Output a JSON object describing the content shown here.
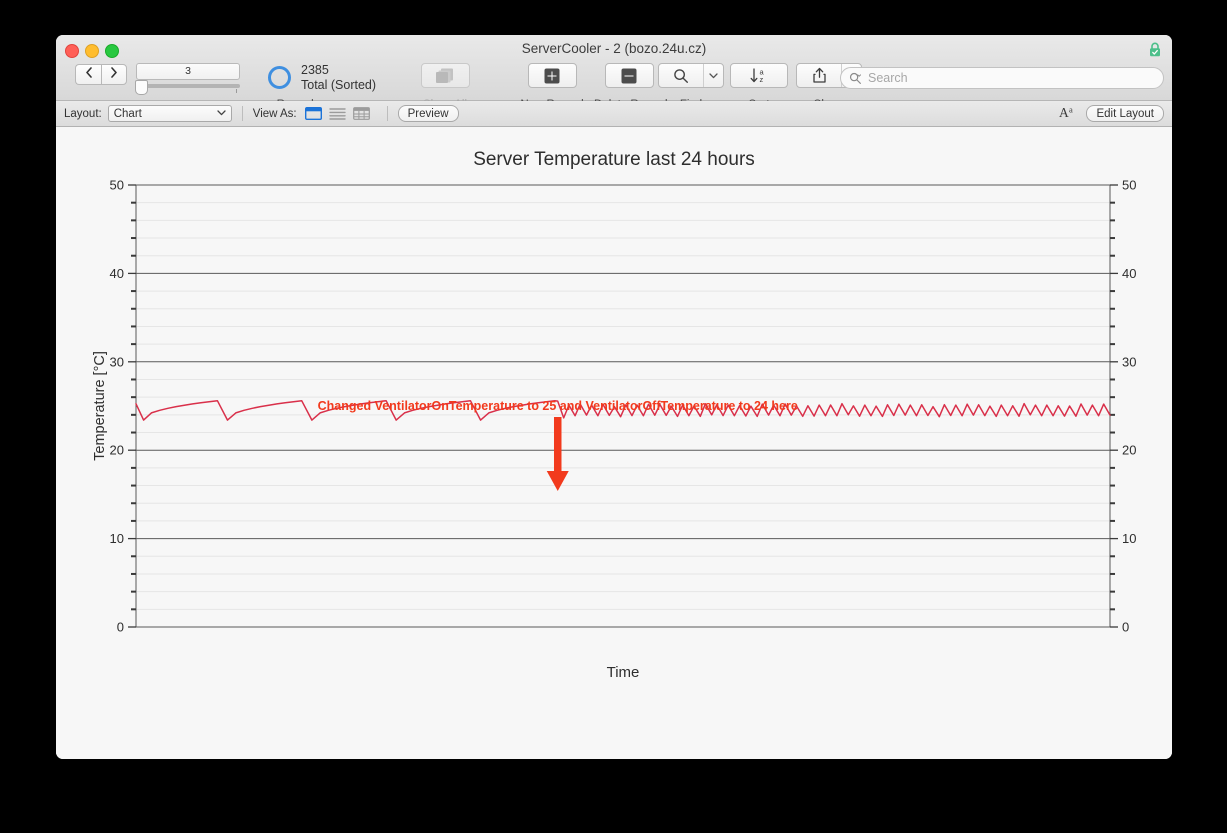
{
  "window": {
    "title": "ServerCooler - 2 (bozo.24u.cz)",
    "lock_icon": "lock-icon",
    "lock_color": "#4cbf8a",
    "traffic_lights": [
      "close-button",
      "minimize-button",
      "maximize-button"
    ]
  },
  "toolbar": {
    "nav_prev_icon": "chevron-left-icon",
    "nav_next_icon": "chevron-right-icon",
    "slider_value": "3",
    "records_label": "Records",
    "record_count": "2385",
    "record_total": "Total (Sorted)",
    "show_all_label": "Show All",
    "show_all_icon": "stacked-records-icon",
    "new_record_label": "New Record",
    "new_record_icon": "plus-icon",
    "delete_record_label": "Delete Record",
    "delete_record_icon": "minus-icon",
    "find_label": "Find",
    "find_icon": "magnifier-icon",
    "sort_label": "Sort",
    "sort_icon": "sort-az-icon",
    "share_label": "Share",
    "share_icon": "share-arrow-icon",
    "dropdown_icon": "chevron-down-icon"
  },
  "search": {
    "icon": "search-icon",
    "placeholder": "Search",
    "value": ""
  },
  "layout_bar": {
    "layout_label": "Layout:",
    "layout_value": "Chart",
    "layout_chevron": "chevron-down-icon",
    "view_as_label": "View As:",
    "view_form_icon": "view-form-icon",
    "view_list_icon": "view-list-icon",
    "view_table_icon": "view-table-icon",
    "view_selected": "view-form-icon",
    "view_selected_color": "#1b73d8",
    "preview_label": "Preview",
    "text_format_icon": "text-format-icon",
    "edit_layout_label": "Edit Layout"
  },
  "chart_data": {
    "type": "line",
    "title": "Server Temperature last 24 hours",
    "xlabel": "Time",
    "ylabel": "Temperature [°C]",
    "ylim": [
      0,
      50
    ],
    "y_ticks": [
      0,
      10,
      20,
      30,
      40,
      50
    ],
    "y_minor_step": 2,
    "x_tick_labels": [],
    "grid": true,
    "legend": false,
    "line_color": "#d9304a",
    "annotation": {
      "text": "Changed VentilatorOnTemperature to 25 and VentilatorOffTemperature to 24 here",
      "color": "#f23a1d",
      "arrow_icon": "down-arrow-annotation",
      "arrow_x_fraction": 0.433
    },
    "series": [
      {
        "name": "Server Temperature",
        "description": "Sawtooth cycling; before the change long slow rises with sharp drops (~23.4-25.6 °C), after the change fast small oscillations (~23.9-25.1 °C)",
        "segment_before": {
          "x_range_fraction": [
            0.0,
            0.433
          ],
          "peak_c": 25.6,
          "trough_c": 23.4,
          "cycles": 5
        },
        "segment_after": {
          "x_range_fraction": [
            0.433,
            1.0
          ],
          "peak_c": 25.1,
          "trough_c": 23.9,
          "cycles": 48
        }
      }
    ]
  }
}
